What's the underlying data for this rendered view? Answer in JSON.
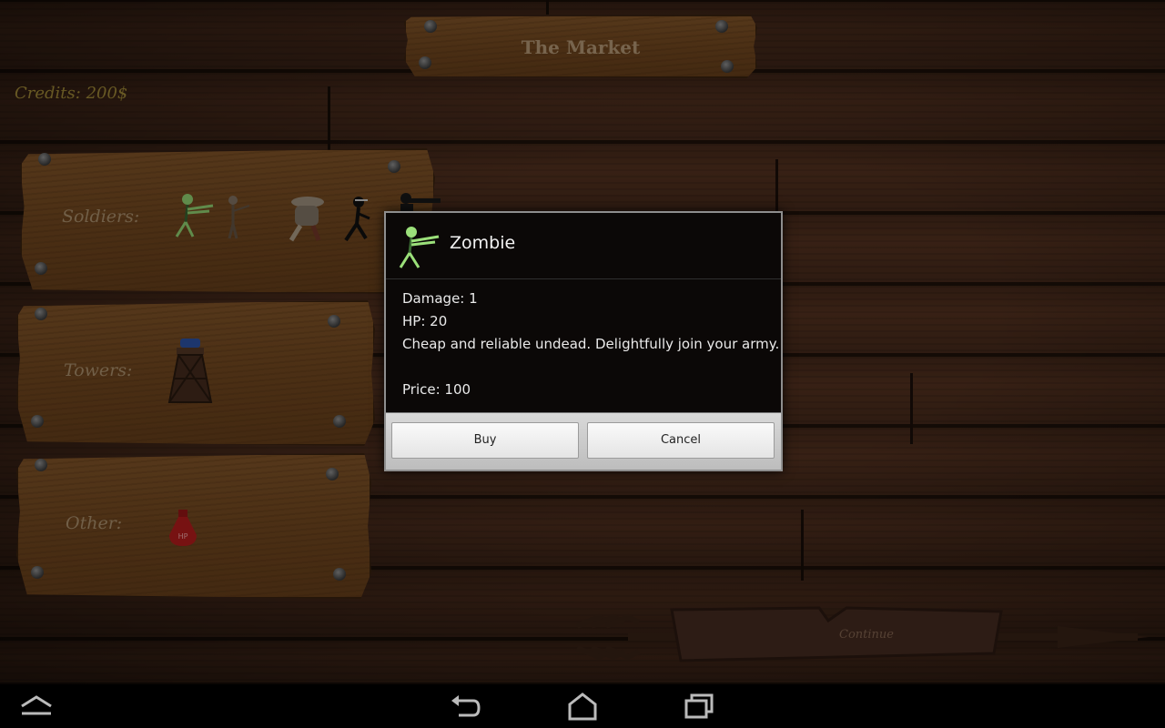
{
  "header": {
    "title": "The Market"
  },
  "credits": {
    "text": "Credits: 200$"
  },
  "categories": [
    {
      "label": "Soldiers:"
    },
    {
      "label": "Towers:"
    },
    {
      "label": "Other:"
    }
  ],
  "items": {
    "soldiers": [
      "zombie-icon",
      "spearman-icon",
      "brute-icon",
      "ninja-icon",
      "gunner-icon"
    ],
    "towers": [
      "watchtower-icon"
    ],
    "other": [
      "hp-potion-icon"
    ],
    "potion_label": "HP"
  },
  "continue": {
    "label": "Continue"
  },
  "dialog": {
    "icon": "zombie-icon",
    "title": "Zombie",
    "damage": "Damage: 1",
    "hp": "HP: 20",
    "description": "Cheap and reliable undead. Delightfully join your army.",
    "price": "Price: 100",
    "buy_label": "Buy",
    "cancel_label": "Cancel"
  },
  "navbar": {
    "items": [
      "menu-up-icon",
      "back-icon",
      "home-icon",
      "recent-apps-icon"
    ]
  },
  "colors": {
    "accent_text": "#a8903a",
    "dialog_bg": "#0b0807",
    "zombie_green": "#9be07a"
  }
}
